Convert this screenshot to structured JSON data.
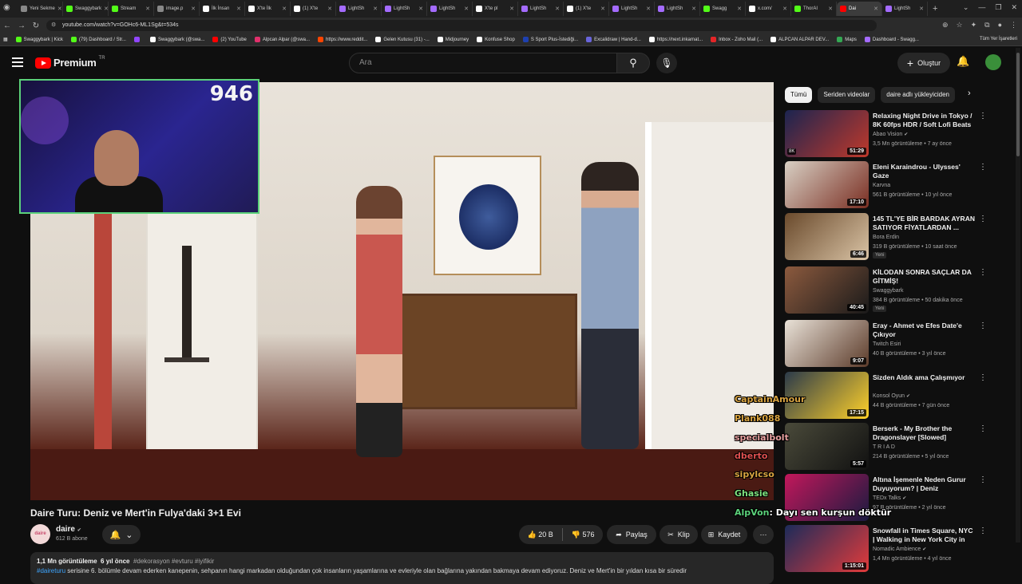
{
  "browser": {
    "tabs": [
      {
        "label": "Yeni Sekme",
        "color": "#888888"
      },
      {
        "label": "Swaggybark",
        "color": "#53fc18"
      },
      {
        "label": "Stream",
        "color": "#53fc18"
      },
      {
        "label": "image.p",
        "color": "#888888"
      },
      {
        "label": "İlk İnsan",
        "color": "#ffffff"
      },
      {
        "label": "X'te İlk",
        "color": "#ffffff"
      },
      {
        "label": "(1) X'te",
        "color": "#ffffff"
      },
      {
        "label": "LightSh",
        "color": "#a46bff"
      },
      {
        "label": "LightSh",
        "color": "#a46bff"
      },
      {
        "label": "LightSh",
        "color": "#a46bff"
      },
      {
        "label": "X'te pl",
        "color": "#ffffff"
      },
      {
        "label": "LightSh",
        "color": "#a46bff"
      },
      {
        "label": "(1) X'te",
        "color": "#ffffff"
      },
      {
        "label": "LightSh",
        "color": "#a46bff"
      },
      {
        "label": "LightSh",
        "color": "#a46bff"
      },
      {
        "label": "Swagg",
        "color": "#53fc18"
      },
      {
        "label": "x.com/",
        "color": "#ffffff"
      },
      {
        "label": "ThorAI",
        "color": "#53fc18"
      },
      {
        "label": "Dai",
        "color": "#ff0000"
      },
      {
        "label": "LightSh",
        "color": "#a46bff"
      }
    ],
    "url": "youtube.com/watch?v=GOHc6-ML1Sg&t=534s",
    "bookmarks": [
      {
        "label": "Swaggybark | Kick",
        "color": "#53fc18"
      },
      {
        "label": "(79) Dashboard / Str...",
        "color": "#53fc18"
      },
      {
        "label": "",
        "color": "#9146ff"
      },
      {
        "label": "Swaggybark (@swa...",
        "color": "#ffffff"
      },
      {
        "label": "(2) YouTube",
        "color": "#ff0000"
      },
      {
        "label": "Alpcan Alpar (@swa...",
        "color": "#e1306c"
      },
      {
        "label": "https://www.reddit...",
        "color": "#ff4500"
      },
      {
        "label": "Gelen Kutusu (31) -...",
        "color": "#ffffff"
      },
      {
        "label": "Midjourney",
        "color": "#ffffff"
      },
      {
        "label": "Konfuse Shop",
        "color": "#ffffff"
      },
      {
        "label": "S Sport Plus-İstediği...",
        "color": "#1e40af"
      },
      {
        "label": "Excalidraw | Hand-d...",
        "color": "#6965db"
      },
      {
        "label": "https://next.inkarnat...",
        "color": "#ffffff"
      },
      {
        "label": "Inbox - Zoho Mail (...",
        "color": "#e42527"
      },
      {
        "label": "ALPCAN ALPAR DEV...",
        "color": "#ffffff"
      },
      {
        "label": "Maps",
        "color": "#34a853"
      },
      {
        "label": "Dashboard - Swagg...",
        "color": "#a46bff"
      }
    ],
    "all_bookmarks": "Tüm Yer İşaretleri"
  },
  "header": {
    "logo_text": "Premium",
    "logo_country": "TR",
    "search_placeholder": "Ara",
    "create_label": "Oluştur"
  },
  "webcam": {
    "viewer_count": "946"
  },
  "video": {
    "title": "Daire Turu: Deniz ve Mert'in Fulya'daki 3+1 Evi",
    "channel_name": "daire",
    "channel_avatar_text": "daire",
    "subscribers": "612 B abone",
    "likes": "20 B",
    "dislikes": "576",
    "share_label": "Paylaş",
    "clip_label": "Klip",
    "save_label": "Kaydet",
    "views": "1,1 Mn görüntüleme",
    "age": "6 yıl önce",
    "tags": "#dekorasyon #evturu #iyifikir",
    "desc_hashtag": "#daireturu",
    "desc_text": " serisine 6. bölümle devam ederken kanepenin, sehpanın hangi markadan olduğundan çok insanların yaşamlarına ve evleriyle olan bağlarına yakından bakmaya devam ediyoruz. Deniz ve Mert'in bir yıldan kısa bir süredir"
  },
  "chips": [
    "Tümü",
    "Seriden videolar",
    "daire adlı yükleyiciden"
  ],
  "recommendations": [
    {
      "title": "Relaxing Night Drive in Tokyo / 8K 60fps HDR / Soft Lofi Beats",
      "channel": "Abao Vision",
      "verified": true,
      "stats": "3,5 Mn görüntüleme • 7 ay önce",
      "duration": "51:29",
      "badge": "8K",
      "new": "",
      "thumb_a": "#1b2450",
      "thumb_b": "#c0392b"
    },
    {
      "title": "Eleni Karaindrou - Ulysses' Gaze",
      "channel": "Karvna",
      "verified": false,
      "stats": "561 B görüntüleme • 10 yıl önce",
      "duration": "17:10",
      "badge": "",
      "new": "",
      "thumb_a": "#d8d0c4",
      "thumb_b": "#7a2e22"
    },
    {
      "title": "145 TL'YE BİR BARDAK AYRAN SATIYOR FİYATLARDAN ...",
      "channel": "Bora Erdin",
      "verified": false,
      "stats": "319 B görüntüleme • 10 saat önce",
      "duration": "6:46",
      "badge": "",
      "new": "Yeni",
      "thumb_a": "#6a4a2c",
      "thumb_b": "#d9c3a5"
    },
    {
      "title": "KİLODAN SONRA SAÇLAR DA GİTMİŞ!",
      "channel": "Swaggybark",
      "verified": false,
      "stats": "384 B görüntüleme • 50 dakika önce",
      "duration": "40:45",
      "badge": "",
      "new": "Yeni",
      "thumb_a": "#8c5a3e",
      "thumb_b": "#1a1a1a"
    },
    {
      "title": "Eray - Ahmet ve Efes Date'e Çıkıyor",
      "channel": "Twitch Esiri",
      "verified": false,
      "stats": "40 B görüntüleme • 3 yıl önce",
      "duration": "9:07",
      "badge": "",
      "new": "",
      "thumb_a": "#e9e2d8",
      "thumb_b": "#5c3b2a"
    },
    {
      "title": "Sizden Aldık ama Çalışmıyor",
      "channel": "Konsol Oyun",
      "verified": true,
      "stats": "44 B görüntüleme • 7 gün önce",
      "duration": "17:15",
      "badge": "",
      "new": "",
      "thumb_a": "#2b3a4a",
      "thumb_b": "#ffd12a"
    },
    {
      "title": "Berserk - My Brother the Dragonslayer [Slowed]",
      "channel": "T R I A D",
      "verified": false,
      "stats": "214 B görüntüleme • 5 yıl önce",
      "duration": "5:57",
      "badge": "",
      "new": "",
      "thumb_a": "#4a4a3a",
      "thumb_b": "#111111"
    },
    {
      "title": "Altına İşemenle Neden Gurur Duyuyorum? | Deniz Dülgeroğl...",
      "channel": "TEDx Talks",
      "verified": true,
      "stats": "97 B görüntüleme • 2 yıl önce",
      "duration": "",
      "badge": "",
      "new": "",
      "thumb_a": "#c2185b",
      "thumb_b": "#1a1a40"
    },
    {
      "title": "Snowfall in Times Square, NYC | Walking in New York City in th...",
      "channel": "Nomadic Ambience",
      "verified": true,
      "stats": "1,4 Mn görüntüleme • 4 yıl önce",
      "duration": "1:15:01",
      "badge": "",
      "new": "",
      "thumb_a": "#1c2b5a",
      "thumb_b": "#e23b3b"
    }
  ],
  "chat": [
    {
      "user": "CaptainAmour",
      "text": "",
      "color": "#d9a441"
    },
    {
      "user": "Plank088",
      "text": "",
      "color": "#d9a441"
    },
    {
      "user": "specialbolt",
      "text": "",
      "color": "#e8a0a0"
    },
    {
      "user": "dberto",
      "text": "",
      "color": "#e05050"
    },
    {
      "user": "sipylcso",
      "text": "",
      "color": "#d9a441"
    },
    {
      "user": "Ghasie",
      "text": "",
      "color": "#7ee07e"
    },
    {
      "user": "AlpVon",
      "text": "Dayı sen kurşun döktür",
      "color": "#5bd17a"
    }
  ]
}
